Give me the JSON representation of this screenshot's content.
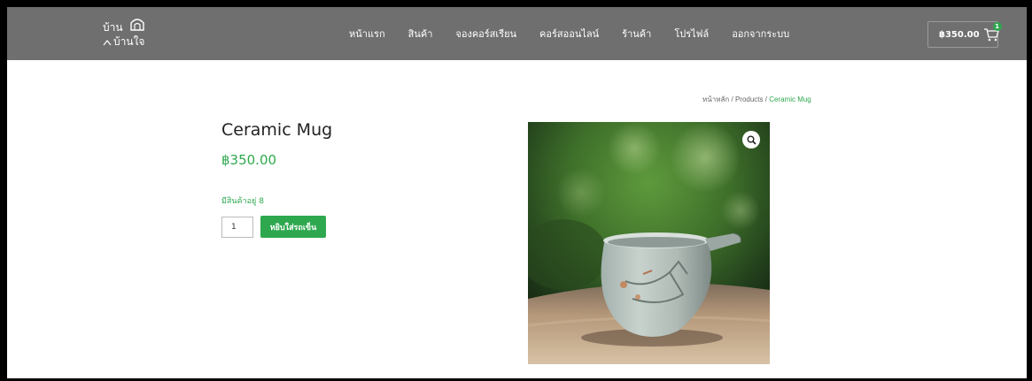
{
  "brand": {
    "line1": "บ้าน",
    "line2": "บ้านใจ"
  },
  "nav": {
    "items": [
      {
        "label": "หน้าแรก"
      },
      {
        "label": "สินค้า"
      },
      {
        "label": "จองคอร์สเรียน"
      },
      {
        "label": "คอร์สออนไลน์"
      },
      {
        "label": "ร้านค้า"
      },
      {
        "label": "โปรไฟล์"
      },
      {
        "label": "ออกจากระบบ"
      }
    ]
  },
  "cart": {
    "total": "฿350.00",
    "count": "1",
    "icon": "shopping-cart-icon"
  },
  "breadcrumb": {
    "home": "หน้าหลัก",
    "sep1": " / ",
    "products": "Products",
    "sep2": " / ",
    "current": "Ceramic Mug"
  },
  "product": {
    "title": "Ceramic Mug",
    "price": "฿350.00",
    "stock": "มีสินค้าอยู่ 8",
    "quantity": "1",
    "add_to_cart_label": "หยิบใส่รถเข็น",
    "zoom_icon": "magnifier-icon"
  },
  "colors": {
    "header_bg": "#6f6f6f",
    "accent": "#2ea84f"
  }
}
